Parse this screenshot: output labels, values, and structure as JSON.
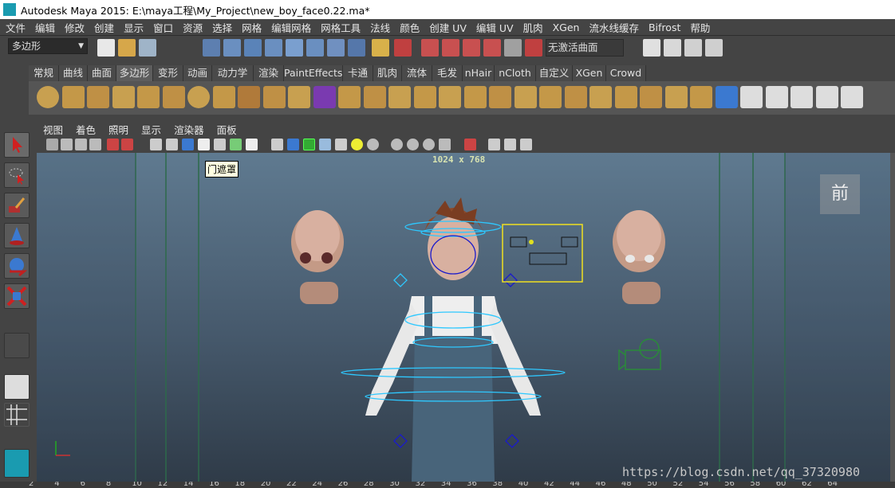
{
  "window": {
    "title": "Autodesk Maya 2015: E:\\maya工程\\My_Project\\new_boy_face0.22.ma*"
  },
  "menubar": [
    "文件",
    "编辑",
    "修改",
    "创建",
    "显示",
    "窗口",
    "资源",
    "选择",
    "网格",
    "编辑网格",
    "网格工具",
    "法线",
    "颜色",
    "创建 UV",
    "编辑 UV",
    "肌肉",
    "XGen",
    "流水线缓存",
    "Bifrost",
    "帮助"
  ],
  "statusline": {
    "mode_dropdown": "多边形",
    "input_field": "无激活曲面"
  },
  "shelf_tabs": [
    "常规",
    "曲线",
    "曲面",
    "多边形",
    "变形",
    "动画",
    "动力学",
    "渲染",
    "PaintEffects",
    "卡通",
    "肌肉",
    "流体",
    "毛发",
    "nHair",
    "nCloth",
    "自定义",
    "XGen",
    "Crowd"
  ],
  "shelf_active_tab": "多边形",
  "panel_menu": [
    "视图",
    "着色",
    "照明",
    "显示",
    "渲染器",
    "面板"
  ],
  "viewport": {
    "resolution_gate": "1024 x 768",
    "tooltip": "门遮罩",
    "view_label": "前",
    "watermark": "https://blog.csdn.net/qq_37320980"
  },
  "timeslider": {
    "ticks": [
      "2",
      "4",
      "6",
      "8",
      "10",
      "12",
      "14",
      "16",
      "18",
      "20",
      "22",
      "24",
      "26",
      "28",
      "30",
      "32",
      "34",
      "36",
      "38",
      "40",
      "42",
      "44",
      "46",
      "48",
      "50",
      "52",
      "54",
      "56",
      "58",
      "60",
      "62",
      "64"
    ]
  },
  "tool_icons": [
    "select-tool-icon",
    "lasso-tool-icon",
    "paint-select-icon",
    "move-tool-icon",
    "rotate-tool-icon",
    "scale-tool-icon"
  ],
  "colors": {
    "accent": "#1a9bb0",
    "viewport_top": "#5f7a90",
    "viewport_bottom": "#2f3b48"
  }
}
